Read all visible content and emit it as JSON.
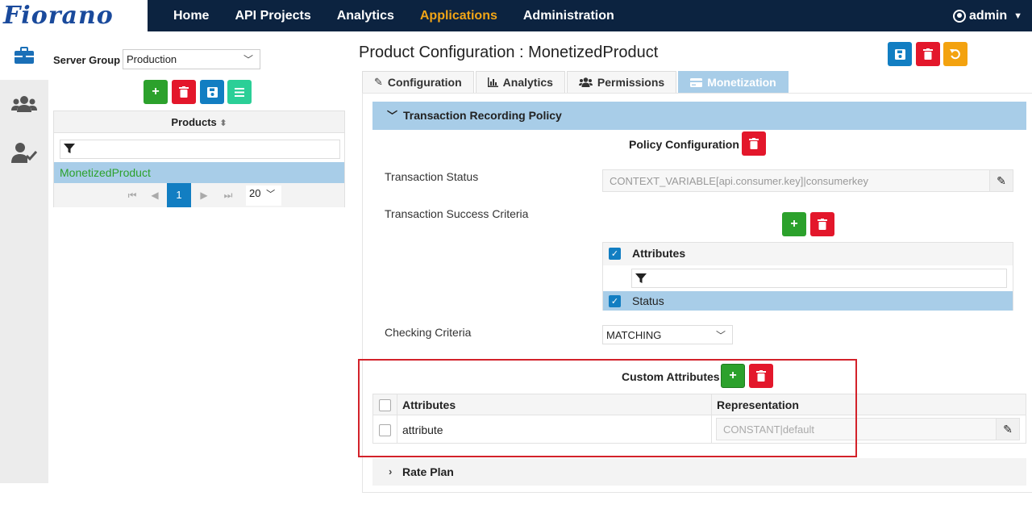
{
  "brand": {
    "logo_text": "Fiorano"
  },
  "nav": {
    "items": [
      {
        "label": "Home"
      },
      {
        "label": "API Projects"
      },
      {
        "label": "Analytics"
      },
      {
        "label": "Applications"
      },
      {
        "label": "Administration"
      }
    ],
    "active": "Applications",
    "user": "admin"
  },
  "left_rail": [
    "briefcase-icon",
    "users-icon",
    "user-check-icon"
  ],
  "sidebar": {
    "server_group_label": "Server Group",
    "server_group_value": "Production",
    "products_header": "Products",
    "products": [
      "MonetizedProduct"
    ],
    "pager": {
      "current_page": "1",
      "page_size": "20"
    }
  },
  "main": {
    "title": "Product Configuration : MonetizedProduct",
    "tabs": [
      {
        "label": "Configuration",
        "icon": "pencil-icon"
      },
      {
        "label": "Analytics",
        "icon": "chart-icon"
      },
      {
        "label": "Permissions",
        "icon": "users-icon"
      },
      {
        "label": "Monetization",
        "icon": "card-icon"
      }
    ],
    "active_tab": "Monetization"
  },
  "transaction_policy": {
    "section_title": "Transaction Recording Policy",
    "policy_configuration_label": "Policy Configuration",
    "transaction_status_label": "Transaction Status",
    "transaction_status_value": "CONTEXT_VARIABLE[api.consumer.key]|consumerkey",
    "success_criteria_label": "Transaction Success Criteria",
    "attributes_header": "Attributes",
    "attribute_rows": [
      "Status"
    ],
    "checking_criteria_label": "Checking Criteria",
    "checking_criteria_value": "MATCHING"
  },
  "custom_attributes": {
    "title": "Custom Attributes",
    "col_attributes": "Attributes",
    "col_representation": "Representation",
    "rows": [
      {
        "attribute": "attribute",
        "representation": "CONSTANT|default"
      }
    ]
  },
  "rate_plan": {
    "title": "Rate Plan"
  },
  "colors": {
    "accent": "#127ec2",
    "nav_bg": "#0c2340",
    "active_nav": "#f2a516",
    "selection": "#a8cde8",
    "highlight_box": "#d3222a"
  }
}
